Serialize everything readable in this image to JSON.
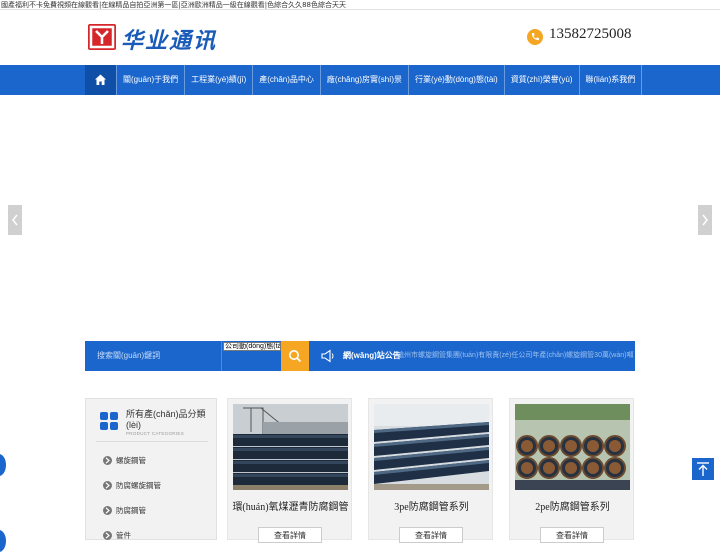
{
  "top_strip": {
    "text": "國產福利不卡免費視頻在線觀看|在線精品自拍亞洲第一區|亞洲歐洲精品一級在線觀看|色綜合久久88色綜合天天"
  },
  "header": {
    "logo_text": "华业通讯",
    "phone": "13582725008"
  },
  "nav": {
    "items": [
      {
        "label": "關(guān)于我們"
      },
      {
        "label": "工程業(yè)績(jī)"
      },
      {
        "label": "產(chǎn)品中心"
      },
      {
        "label": "廠(chǎng)房實(shí)景"
      },
      {
        "label": "行業(yè)動(dòng)態(tài)"
      },
      {
        "label": "資質(zhì)榮譽(yù)"
      },
      {
        "label": "聯(lián)系我們"
      }
    ]
  },
  "search": {
    "placeholder": "搜索關(guān)鍵詞",
    "select_value": "公司動(dòng)態(tài)"
  },
  "notice": {
    "title": "網(wǎng)站公告",
    "text": "滄州市螺旋鋼管集團(tuán)有限責(zé)任公司年產(chǎn)螺旋鋼管30萬(wàn)噸"
  },
  "sidebar": {
    "title": "所有產(chǎn)品分類(lèi)",
    "subtitle": "PRODUCT CATEGORIES",
    "items": [
      {
        "label": "螺旋鋼管"
      },
      {
        "label": "防腐螺旋鋼管"
      },
      {
        "label": "防腐鋼管"
      },
      {
        "label": "管件"
      }
    ]
  },
  "products": [
    {
      "name": "環(huán)氧煤瀝青防腐鋼管",
      "button": "查看詳情"
    },
    {
      "name": "3pe防腐鋼管系列",
      "button": "查看詳情"
    },
    {
      "name": "2pe防腐鋼管系列",
      "button": "查看詳情"
    }
  ],
  "colors": {
    "nav_blue": "#1a66cc",
    "accent_orange": "#f5a623",
    "logo_red": "#d7262a"
  }
}
